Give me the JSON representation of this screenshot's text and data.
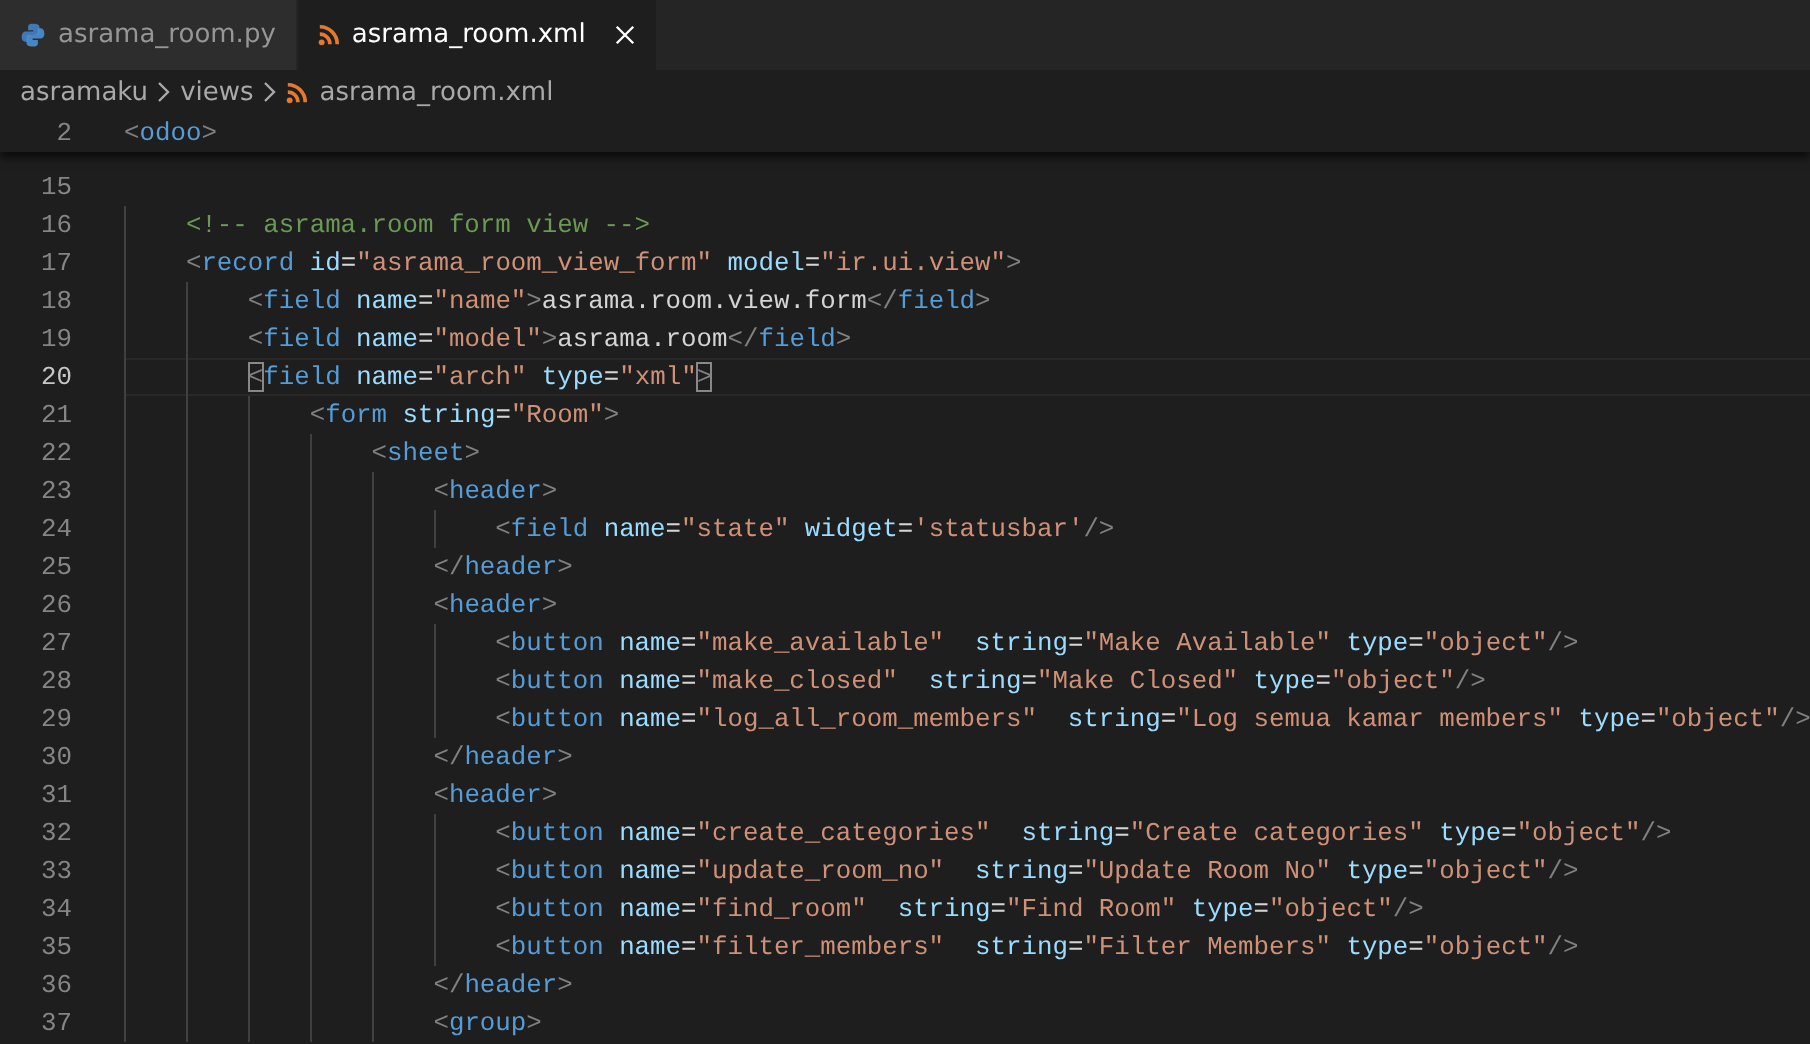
{
  "tabs": [
    {
      "label": "asrama_room.py",
      "kind": "python",
      "selected": false
    },
    {
      "label": "asrama_room.xml",
      "kind": "xml",
      "selected": true
    }
  ],
  "breadcrumb": [
    {
      "label": "asramaku",
      "kind": "folder"
    },
    {
      "label": "views",
      "kind": "folder"
    },
    {
      "label": "asrama_room.xml",
      "kind": "xml"
    }
  ],
  "sticky_line": {
    "number": "2",
    "tokens": [
      {
        "kind": "p",
        "text": "<"
      },
      {
        "kind": "tag",
        "text": "odoo"
      },
      {
        "kind": "p",
        "text": ">"
      }
    ]
  },
  "lines": [
    {
      "number": "15"
    },
    {
      "number": "16",
      "tokens": [
        {
          "kind": "cmt",
          "text": "    <!-- asrama.room form view -->"
        }
      ]
    },
    {
      "number": "17",
      "tokens": [
        {
          "kind": "p",
          "text": "    <"
        },
        {
          "kind": "tag",
          "text": "record"
        },
        {
          "kind": "attr",
          "text": " id"
        },
        {
          "kind": "eq",
          "text": "="
        },
        {
          "kind": "str",
          "text": "\"asrama_room_view_form\""
        },
        {
          "kind": "attr",
          "text": " model"
        },
        {
          "kind": "eq",
          "text": "="
        },
        {
          "kind": "str",
          "text": "\"ir.ui.view\""
        },
        {
          "kind": "p",
          "text": ">"
        }
      ]
    },
    {
      "number": "18",
      "tokens": [
        {
          "kind": "p",
          "text": "        <"
        },
        {
          "kind": "tag",
          "text": "field"
        },
        {
          "kind": "attr",
          "text": " name"
        },
        {
          "kind": "eq",
          "text": "="
        },
        {
          "kind": "str",
          "text": "\"name\""
        },
        {
          "kind": "p",
          "text": ">"
        },
        {
          "kind": "txt",
          "text": "asrama.room.view.form"
        },
        {
          "kind": "p",
          "text": "</"
        },
        {
          "kind": "tag",
          "text": "field"
        },
        {
          "kind": "p",
          "text": ">"
        }
      ]
    },
    {
      "number": "19",
      "tokens": [
        {
          "kind": "p",
          "text": "        <"
        },
        {
          "kind": "tag",
          "text": "field"
        },
        {
          "kind": "attr",
          "text": " name"
        },
        {
          "kind": "eq",
          "text": "="
        },
        {
          "kind": "str",
          "text": "\"model\""
        },
        {
          "kind": "p",
          "text": ">"
        },
        {
          "kind": "txt",
          "text": "asrama.room"
        },
        {
          "kind": "p",
          "text": "</"
        },
        {
          "kind": "tag",
          "text": "field"
        },
        {
          "kind": "p",
          "text": ">"
        }
      ]
    },
    {
      "number": "20",
      "current": true,
      "tokens": [
        {
          "kind": "bm",
          "text": "        <"
        },
        {
          "kind": "tag",
          "text": "field"
        },
        {
          "kind": "attr",
          "text": " name"
        },
        {
          "kind": "eq",
          "text": "="
        },
        {
          "kind": "str",
          "text": "\"arch\""
        },
        {
          "kind": "attr",
          "text": " type"
        },
        {
          "kind": "eq",
          "text": "="
        },
        {
          "kind": "str",
          "text": "\"xml\""
        },
        {
          "kind": "bm",
          "text": ">"
        }
      ]
    },
    {
      "number": "21",
      "tokens": [
        {
          "kind": "p",
          "text": "            <"
        },
        {
          "kind": "tag",
          "text": "form"
        },
        {
          "kind": "attr",
          "text": " string"
        },
        {
          "kind": "eq",
          "text": "="
        },
        {
          "kind": "str",
          "text": "\"Room\""
        },
        {
          "kind": "p",
          "text": ">"
        }
      ]
    },
    {
      "number": "22",
      "tokens": [
        {
          "kind": "p",
          "text": "                <"
        },
        {
          "kind": "tag",
          "text": "sheet"
        },
        {
          "kind": "p",
          "text": ">"
        }
      ]
    },
    {
      "number": "23",
      "tokens": [
        {
          "kind": "p",
          "text": "                    <"
        },
        {
          "kind": "tag",
          "text": "header"
        },
        {
          "kind": "p",
          "text": ">"
        }
      ]
    },
    {
      "number": "24",
      "tokens": [
        {
          "kind": "p",
          "text": "                        <"
        },
        {
          "kind": "tag",
          "text": "field"
        },
        {
          "kind": "attr",
          "text": " name"
        },
        {
          "kind": "eq",
          "text": "="
        },
        {
          "kind": "str",
          "text": "\"state\""
        },
        {
          "kind": "attr",
          "text": " widget"
        },
        {
          "kind": "eq",
          "text": "="
        },
        {
          "kind": "str",
          "text": "'statusbar'"
        },
        {
          "kind": "p",
          "text": "/>"
        }
      ]
    },
    {
      "number": "25",
      "tokens": [
        {
          "kind": "p",
          "text": "                    </"
        },
        {
          "kind": "tag",
          "text": "header"
        },
        {
          "kind": "p",
          "text": ">"
        }
      ]
    },
    {
      "number": "26",
      "tokens": [
        {
          "kind": "p",
          "text": "                    <"
        },
        {
          "kind": "tag",
          "text": "header"
        },
        {
          "kind": "p",
          "text": ">"
        }
      ]
    },
    {
      "number": "27",
      "tokens": [
        {
          "kind": "p",
          "text": "                        <"
        },
        {
          "kind": "tag",
          "text": "button"
        },
        {
          "kind": "attr",
          "text": " name"
        },
        {
          "kind": "eq",
          "text": "="
        },
        {
          "kind": "str",
          "text": "\"make_available\""
        },
        {
          "kind": "attr",
          "text": "  string"
        },
        {
          "kind": "eq",
          "text": "="
        },
        {
          "kind": "str",
          "text": "\"Make Available\""
        },
        {
          "kind": "attr",
          "text": " type"
        },
        {
          "kind": "eq",
          "text": "="
        },
        {
          "kind": "str",
          "text": "\"object\""
        },
        {
          "kind": "p",
          "text": "/>"
        }
      ]
    },
    {
      "number": "28",
      "tokens": [
        {
          "kind": "p",
          "text": "                        <"
        },
        {
          "kind": "tag",
          "text": "button"
        },
        {
          "kind": "attr",
          "text": " name"
        },
        {
          "kind": "eq",
          "text": "="
        },
        {
          "kind": "str",
          "text": "\"make_closed\""
        },
        {
          "kind": "attr",
          "text": "  string"
        },
        {
          "kind": "eq",
          "text": "="
        },
        {
          "kind": "str",
          "text": "\"Make Closed\""
        },
        {
          "kind": "attr",
          "text": " type"
        },
        {
          "kind": "eq",
          "text": "="
        },
        {
          "kind": "str",
          "text": "\"object\""
        },
        {
          "kind": "p",
          "text": "/>"
        }
      ]
    },
    {
      "number": "29",
      "tokens": [
        {
          "kind": "p",
          "text": "                        <"
        },
        {
          "kind": "tag",
          "text": "button"
        },
        {
          "kind": "attr",
          "text": " name"
        },
        {
          "kind": "eq",
          "text": "="
        },
        {
          "kind": "str",
          "text": "\"log_all_room_members\""
        },
        {
          "kind": "attr",
          "text": "  string"
        },
        {
          "kind": "eq",
          "text": "="
        },
        {
          "kind": "str",
          "text": "\"Log semua kamar members\""
        },
        {
          "kind": "attr",
          "text": " type"
        },
        {
          "kind": "eq",
          "text": "="
        },
        {
          "kind": "str",
          "text": "\"object\""
        },
        {
          "kind": "p",
          "text": "/>"
        }
      ]
    },
    {
      "number": "30",
      "tokens": [
        {
          "kind": "p",
          "text": "                    </"
        },
        {
          "kind": "tag",
          "text": "header"
        },
        {
          "kind": "p",
          "text": ">"
        }
      ]
    },
    {
      "number": "31",
      "tokens": [
        {
          "kind": "p",
          "text": "                    <"
        },
        {
          "kind": "tag",
          "text": "header"
        },
        {
          "kind": "p",
          "text": ">"
        }
      ]
    },
    {
      "number": "32",
      "tokens": [
        {
          "kind": "p",
          "text": "                        <"
        },
        {
          "kind": "tag",
          "text": "button"
        },
        {
          "kind": "attr",
          "text": " name"
        },
        {
          "kind": "eq",
          "text": "="
        },
        {
          "kind": "str",
          "text": "\"create_categories\""
        },
        {
          "kind": "attr",
          "text": "  string"
        },
        {
          "kind": "eq",
          "text": "="
        },
        {
          "kind": "str",
          "text": "\"Create categories\""
        },
        {
          "kind": "attr",
          "text": " type"
        },
        {
          "kind": "eq",
          "text": "="
        },
        {
          "kind": "str",
          "text": "\"object\""
        },
        {
          "kind": "p",
          "text": "/>"
        }
      ]
    },
    {
      "number": "33",
      "tokens": [
        {
          "kind": "p",
          "text": "                        <"
        },
        {
          "kind": "tag",
          "text": "button"
        },
        {
          "kind": "attr",
          "text": " name"
        },
        {
          "kind": "eq",
          "text": "="
        },
        {
          "kind": "str",
          "text": "\"update_room_no\""
        },
        {
          "kind": "attr",
          "text": "  string"
        },
        {
          "kind": "eq",
          "text": "="
        },
        {
          "kind": "str",
          "text": "\"Update Room No\""
        },
        {
          "kind": "attr",
          "text": " type"
        },
        {
          "kind": "eq",
          "text": "="
        },
        {
          "kind": "str",
          "text": "\"object\""
        },
        {
          "kind": "p",
          "text": "/>"
        }
      ]
    },
    {
      "number": "34",
      "tokens": [
        {
          "kind": "p",
          "text": "                        <"
        },
        {
          "kind": "tag",
          "text": "button"
        },
        {
          "kind": "attr",
          "text": " name"
        },
        {
          "kind": "eq",
          "text": "="
        },
        {
          "kind": "str",
          "text": "\"find_room\""
        },
        {
          "kind": "attr",
          "text": "  string"
        },
        {
          "kind": "eq",
          "text": "="
        },
        {
          "kind": "str",
          "text": "\"Find Room\""
        },
        {
          "kind": "attr",
          "text": " type"
        },
        {
          "kind": "eq",
          "text": "="
        },
        {
          "kind": "str",
          "text": "\"object\""
        },
        {
          "kind": "p",
          "text": "/>"
        }
      ]
    },
    {
      "number": "35",
      "tokens": [
        {
          "kind": "p",
          "text": "                        <"
        },
        {
          "kind": "tag",
          "text": "button"
        },
        {
          "kind": "attr",
          "text": " name"
        },
        {
          "kind": "eq",
          "text": "="
        },
        {
          "kind": "str",
          "text": "\"filter_members\""
        },
        {
          "kind": "attr",
          "text": "  string"
        },
        {
          "kind": "eq",
          "text": "="
        },
        {
          "kind": "str",
          "text": "\"Filter Members\""
        },
        {
          "kind": "attr",
          "text": " type"
        },
        {
          "kind": "eq",
          "text": "="
        },
        {
          "kind": "str",
          "text": "\"object\""
        },
        {
          "kind": "p",
          "text": "/>"
        }
      ]
    },
    {
      "number": "36",
      "tokens": [
        {
          "kind": "p",
          "text": "                    </"
        },
        {
          "kind": "tag",
          "text": "header"
        },
        {
          "kind": "p",
          "text": ">"
        }
      ]
    },
    {
      "number": "37",
      "tokens": [
        {
          "kind": "p",
          "text": "                    <"
        },
        {
          "kind": "tag",
          "text": "group"
        },
        {
          "kind": "p",
          "text": ">"
        }
      ]
    }
  ]
}
